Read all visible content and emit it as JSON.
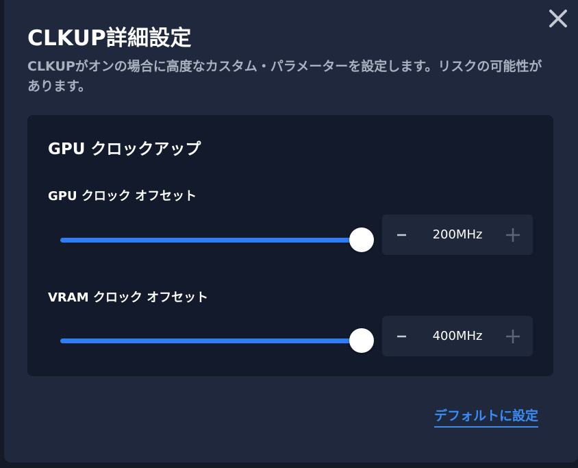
{
  "dialog": {
    "title": "CLKUP詳細設定",
    "description": "CLKUPがオンの場合に高度なカスタム・パラメーターを設定します。リスクの可能性があります。",
    "close_icon": "close-icon"
  },
  "panel": {
    "title": "GPU クロックアップ",
    "settings": [
      {
        "label": "GPU クロック オフセット",
        "value": "200MHz",
        "slider_level_percent": 100
      },
      {
        "label": "VRAM クロック オフセット",
        "value": "400MHz",
        "slider_level_percent": 100
      }
    ]
  },
  "footer": {
    "reset_label": "デフォルトに設定"
  },
  "colors": {
    "accent": "#2f7df6",
    "link": "#3b8cf5",
    "dialog_bg": "#1f283d",
    "panel_bg": "#121a2b"
  }
}
